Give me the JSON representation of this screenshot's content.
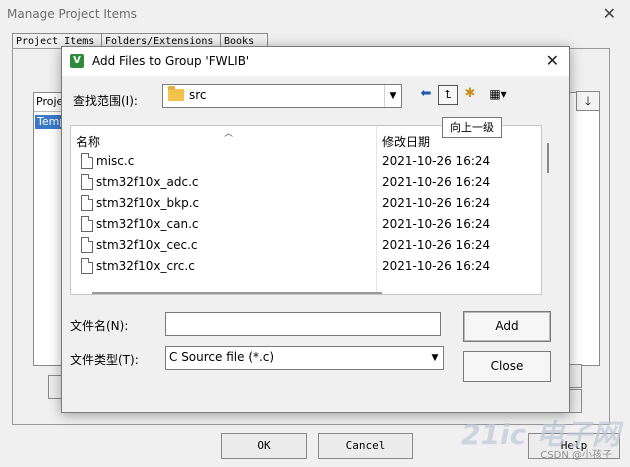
{
  "background_window": {
    "title": "Manage Project Items",
    "tabs": [
      "Project Items",
      "Folders/Extensions",
      "Books"
    ],
    "list_header": "Projec",
    "list_selected": "Temp",
    "buttons": {
      "ok": "OK",
      "cancel": "Cancel",
      "help": "Help"
    }
  },
  "dialog": {
    "title": "Add Files to Group 'FWLIB'",
    "app_icon_letter": "V",
    "look_in": {
      "label": "查找范围(I):",
      "value": "src"
    },
    "toolbar": {
      "tooltip": "向上一级"
    },
    "columns": {
      "name": "名称",
      "date": "修改日期"
    },
    "files": [
      {
        "name": "misc.c",
        "date": "2021-10-26 16:24"
      },
      {
        "name": "stm32f10x_adc.c",
        "date": "2021-10-26 16:24"
      },
      {
        "name": "stm32f10x_bkp.c",
        "date": "2021-10-26 16:24"
      },
      {
        "name": "stm32f10x_can.c",
        "date": "2021-10-26 16:24"
      },
      {
        "name": "stm32f10x_cec.c",
        "date": "2021-10-26 16:24"
      },
      {
        "name": "stm32f10x_crc.c",
        "date": "2021-10-26 16:24"
      }
    ],
    "filename": {
      "label": "文件名(N):",
      "value": ""
    },
    "filetype": {
      "label": "文件类型(T):",
      "value": "C Source file (*.c)"
    },
    "buttons": {
      "add": "Add",
      "close": "Close"
    }
  },
  "watermark": {
    "brand": "21ic 电子网",
    "source": "CSDN @小孩子"
  }
}
